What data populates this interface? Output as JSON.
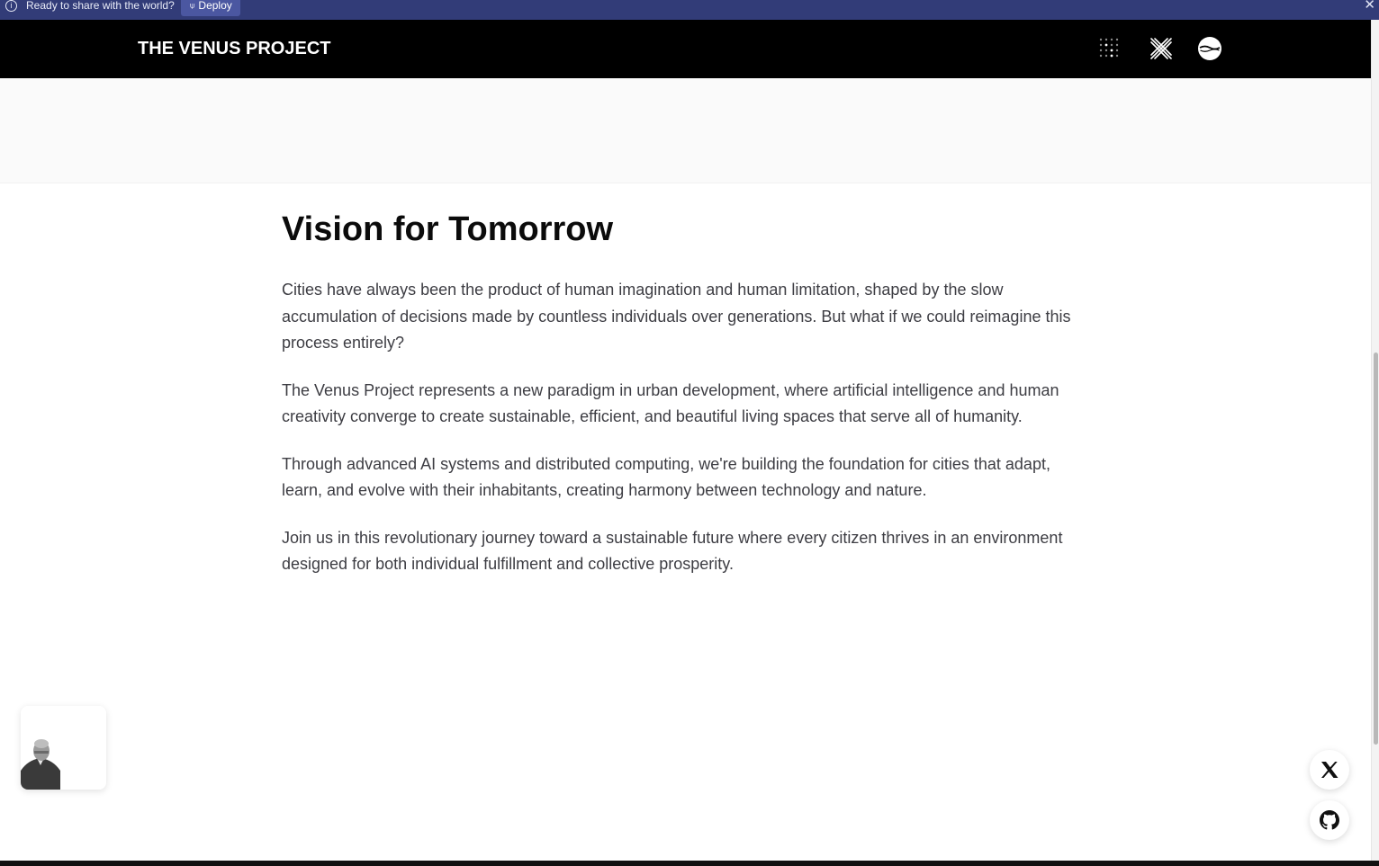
{
  "banner": {
    "message": "Ready to share with the world?",
    "deploy_label": "Deploy",
    "info_glyph": "i",
    "deploy_glyph": "⍦",
    "close_glyph": "✕",
    "background": "#323c78"
  },
  "navbar": {
    "brand": "THE VENUS PROJECT",
    "icons": [
      "dot-grid-icon",
      "crossed-lines-icon",
      "globe-icon"
    ],
    "background": "#000000"
  },
  "article": {
    "title": "Vision for Tomorrow",
    "paragraphs": [
      "Cities have always been the product of human imagination and human limitation, shaped by the slow accumulation of decisions made by countless individuals over generations. But what if we could reimagine this process entirely?",
      "The Venus Project represents a new paradigm in urban development, where artificial intelligence and human creativity converge to create sustainable, efficient, and beautiful living spaces that serve all of humanity.",
      "Through advanced AI systems and distributed computing, we're building the foundation for cities that adapt, learn, and evolve with their inhabitants, creating harmony between technology and nature.",
      "Join us in this revolutionary journey toward a sustainable future where every citizen thrives in an environment designed for both individual fulfillment and collective prosperity."
    ]
  },
  "floating": {
    "avatar_icon": "person-portrait-icon",
    "social_icons": [
      "x-logo-icon",
      "github-icon"
    ]
  }
}
